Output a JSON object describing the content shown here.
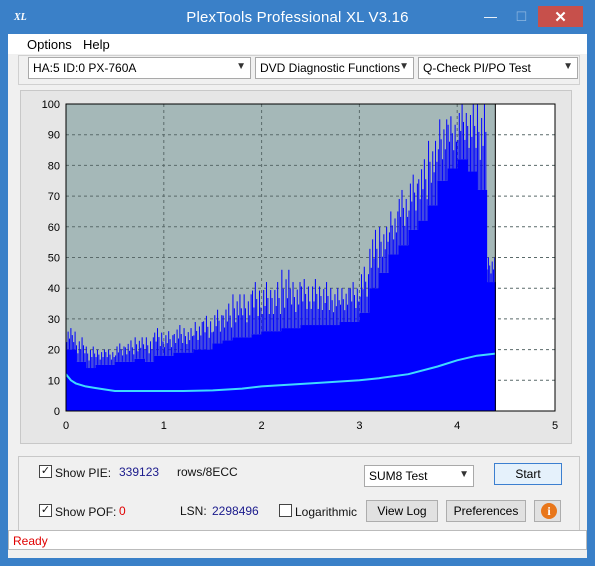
{
  "window": {
    "title": "PlexTools Professional XL V3.16",
    "app_icon_text": "XL",
    "minimize_symbol": "—",
    "maximize_symbol": "☐",
    "close_symbol": "✕"
  },
  "menu": {
    "options": "Options",
    "help": "Help"
  },
  "toolbar": {
    "drive": "HA:5 ID:0  PX-760A",
    "function": "DVD Diagnostic Functions",
    "test": "Q-Check PI/PO Test",
    "dropdown_arrow": "▼"
  },
  "chart_data": {
    "type": "bar",
    "x_ticks": [
      0,
      1,
      2,
      3,
      4,
      5
    ],
    "y_ticks": [
      0,
      10,
      20,
      30,
      40,
      50,
      60,
      70,
      80,
      90,
      100
    ],
    "xlim": [
      0,
      5
    ],
    "ylim": [
      0,
      100
    ],
    "grid": true,
    "plot_background": "#a5b8b8",
    "bar_color": "#0000ff",
    "line_color": "#3fd9ff",
    "test_end_x": 4.39,
    "series": [
      {
        "kind": "bars",
        "x": [
          0.05,
          0.15,
          0.25,
          0.35,
          0.45,
          0.55,
          0.65,
          0.75,
          0.85,
          0.95,
          1.05,
          1.15,
          1.25,
          1.35,
          1.45,
          1.55,
          1.65,
          1.75,
          1.85,
          1.95,
          2.05,
          2.15,
          2.25,
          2.35,
          2.45,
          2.55,
          2.65,
          2.75,
          2.85,
          2.95,
          3.05,
          3.15,
          3.25,
          3.35,
          3.45,
          3.55,
          3.65,
          3.75,
          3.85,
          3.95,
          4.05,
          4.15,
          4.25,
          4.35
        ],
        "values": [
          20,
          16,
          14,
          15,
          15,
          16,
          16,
          17,
          16,
          18,
          18,
          19,
          19,
          20,
          20,
          22,
          23,
          24,
          24,
          25,
          26,
          26,
          27,
          27,
          28,
          28,
          28,
          28,
          29,
          29,
          32,
          40,
          45,
          51,
          54,
          59,
          62,
          67,
          75,
          79,
          82,
          78,
          72,
          42
        ],
        "peaks": [
          27,
          24,
          21,
          20,
          20,
          22,
          23,
          24,
          24,
          27,
          26,
          28,
          27,
          29,
          31,
          33,
          35,
          38,
          38,
          42,
          42,
          42,
          46,
          42,
          43,
          43,
          42,
          40,
          40,
          42,
          47,
          59,
          60,
          65,
          72,
          77,
          82,
          88,
          95,
          96,
          100,
          100,
          100,
          50
        ]
      },
      {
        "kind": "line",
        "x": [
          0.0,
          0.05,
          0.1,
          0.2,
          0.3,
          0.4,
          0.5,
          0.7,
          1.0,
          1.2,
          1.5,
          1.8,
          2.0,
          2.5,
          3.0,
          3.2,
          3.5,
          3.8,
          4.0,
          4.2,
          4.39
        ],
        "values": [
          12,
          10,
          9,
          8,
          7.5,
          7,
          6.5,
          6.5,
          6.5,
          6.5,
          6.7,
          7.3,
          8,
          9,
          10,
          10.7,
          12,
          14.5,
          16.5,
          18,
          18.7
        ]
      }
    ]
  },
  "stats": {
    "show_pie_label": "Show PIE:",
    "pie_value": "339123",
    "pie_unit": "rows/8ECC",
    "show_poe_label": "Show POF:",
    "poe_value": "0",
    "lsn_label": "LSN:",
    "lsn_value": "2298496",
    "logarithmic_label": "Logarithmic",
    "check_mark": "✓"
  },
  "controls": {
    "sum_select": "SUM8 Test",
    "start_label": "Start",
    "view_log_label": "View Log",
    "preferences_label": "Preferences",
    "info_symbol": "i"
  },
  "status": {
    "text": "Ready"
  }
}
